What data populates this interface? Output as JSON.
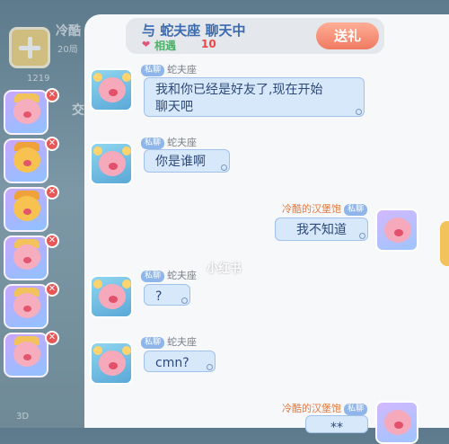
{
  "background": {
    "title_partial": "冷酷",
    "subtitle_partial": "20局",
    "count": "1219",
    "side_text": "交",
    "bottom_left": "3D"
  },
  "header": {
    "title": "与 蛇夫座 聊天中",
    "relation_label": "相遇",
    "relation_level": "10",
    "gift_button": "送礼",
    "heart_icon": "heart-icon"
  },
  "colors": {
    "panel": "#f7f8fa",
    "bubble": "#d7e8fb",
    "gift": "#f07a61",
    "title": "#3d6bb0",
    "relation": "#4fb06b",
    "level": "#e84848"
  },
  "private_tag": "私聊",
  "messages": [
    {
      "sender": "蛇夫座",
      "side": "left",
      "text_lines": [
        "我和你已经是好友了,现在开始",
        "聊天吧"
      ]
    },
    {
      "sender": "蛇夫座",
      "side": "left",
      "text_lines": [
        "你是谁啊"
      ]
    },
    {
      "sender": "冷酷的汉堡饱",
      "side": "right",
      "text_lines": [
        "我不知道"
      ]
    },
    {
      "sender": "蛇夫座",
      "side": "left",
      "text_lines": [
        "?"
      ]
    },
    {
      "sender": "蛇夫座",
      "side": "left",
      "text_lines": [
        "cmn?"
      ]
    },
    {
      "sender": "冷酷的汉堡饱",
      "side": "right",
      "text_lines": [
        "**"
      ]
    }
  ],
  "watermark": "小红书",
  "friends": [
    {
      "hat_color": "#f2c35a"
    },
    {
      "hat_color": "#f0a23a"
    },
    {
      "hat_color": "#f0a23a"
    },
    {
      "hat_color": "#f2c35a"
    },
    {
      "hat_color": "#f2c35a"
    },
    {
      "hat_color": "#f2c35a"
    }
  ]
}
